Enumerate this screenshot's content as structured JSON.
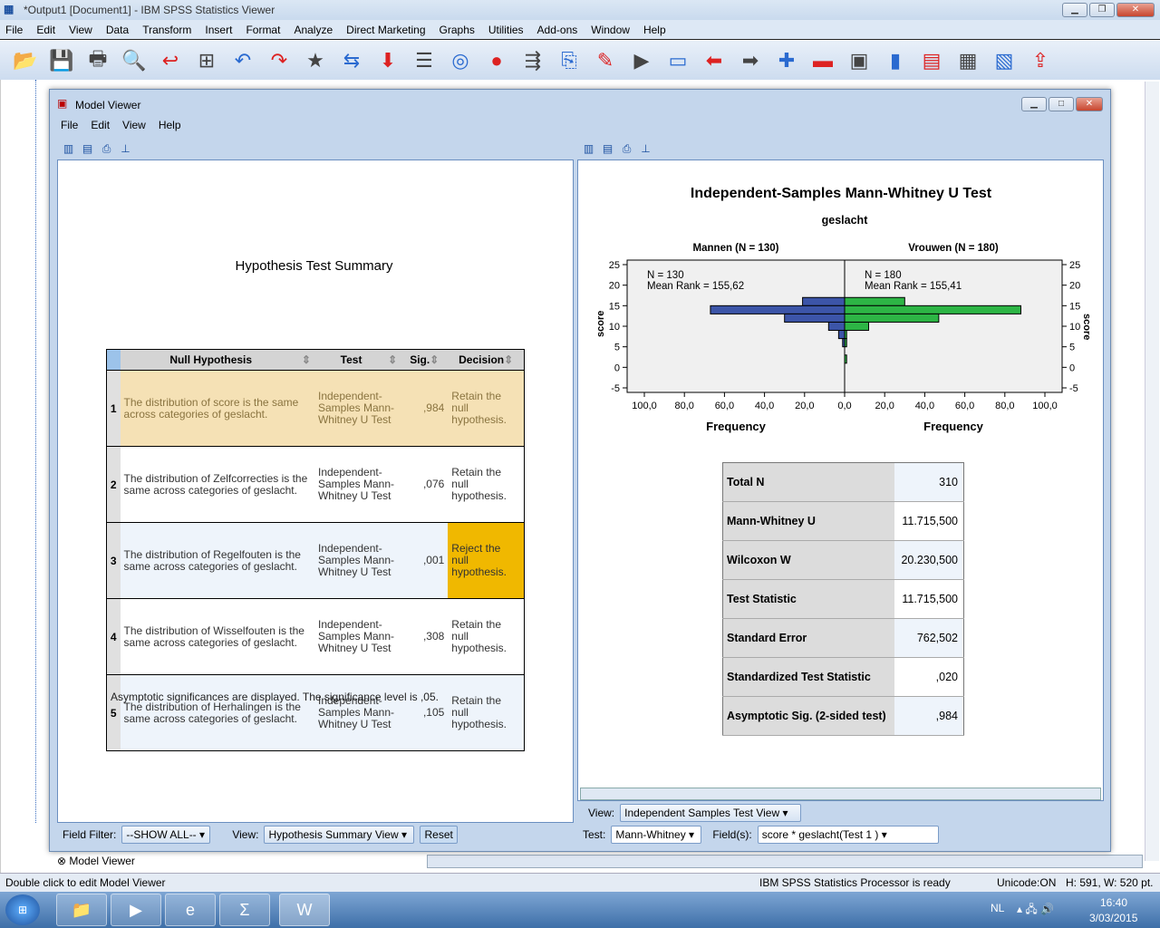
{
  "app": {
    "title": "*Output1 [Document1] - IBM SPSS Statistics Viewer",
    "menu": [
      "File",
      "Edit",
      "View",
      "Data",
      "Transform",
      "Insert",
      "Format",
      "Analyze",
      "Direct Marketing",
      "Graphs",
      "Utilities",
      "Add-ons",
      "Window",
      "Help"
    ],
    "toolbar_icons": [
      "open-icon",
      "save-icon",
      "print-icon",
      "print-preview-icon",
      "export-icon",
      "recall-dialog-icon",
      "undo-icon",
      "redo-icon",
      "goto-case-icon",
      "goto-variable-icon",
      "insert-cases-icon",
      "variables-icon",
      "select-icon",
      "weight-icon",
      "output-outline-icon",
      "insert-output-icon",
      "script-icon",
      "play-icon",
      "designate-window-icon",
      "back-icon",
      "forward-icon",
      "expand-icon",
      "collapse-icon",
      "show-icon",
      "hide-icon",
      "insert-heading-icon",
      "insert-title-icon",
      "insert-text-icon",
      "export-output-icon"
    ],
    "outline_item": "Model Viewer"
  },
  "model_viewer": {
    "title": "Model Viewer",
    "menu": [
      "File",
      "Edit",
      "View",
      "Help"
    ],
    "left": {
      "title": "Hypothesis Test Summary",
      "columns": [
        "Null Hypothesis",
        "Test",
        "Sig.",
        "Decision"
      ],
      "rows": [
        {
          "n": "1",
          "hyp": "The distribution of score is the same across categories of geslacht.",
          "test": "Independent-Samples Mann-Whitney U Test",
          "sig": ",984",
          "decision": "Retain the null hypothesis."
        },
        {
          "n": "2",
          "hyp": "The distribution of Zelfcorrecties is the same across categories of geslacht.",
          "test": "Independent-Samples Mann-Whitney U Test",
          "sig": ",076",
          "decision": "Retain the null hypothesis."
        },
        {
          "n": "3",
          "hyp": "The distribution of Regelfouten is the same across categories of geslacht.",
          "test": "Independent-Samples Mann-Whitney U Test",
          "sig": ",001",
          "decision": "Reject the null hypothesis."
        },
        {
          "n": "4",
          "hyp": "The distribution of Wisselfouten is the same across categories of geslacht.",
          "test": "Independent-Samples Mann-Whitney U Test",
          "sig": ",308",
          "decision": "Retain the null hypothesis."
        },
        {
          "n": "5",
          "hyp": "The distribution of Herhalingen is the same across categories of geslacht.",
          "test": "Independent-Samples Mann-Whitney U Test",
          "sig": ",105",
          "decision": "Retain the null hypothesis."
        }
      ],
      "footnote": "Asymptotic significances are displayed.  The significance level is ,05.",
      "field_filter_label": "Field Filter:",
      "field_filter_value": "--SHOW ALL--",
      "view_label": "View:",
      "view_value": "Hypothesis Summary View",
      "reset_label": "Reset"
    },
    "right": {
      "title": "Independent-Samples Mann-Whitney U Test",
      "subtitle": "geslacht",
      "stats": [
        {
          "label": "Total N",
          "value": "310"
        },
        {
          "label": "Mann-Whitney U",
          "value": "11.715,500"
        },
        {
          "label": "Wilcoxon W",
          "value": "20.230,500"
        },
        {
          "label": "Test Statistic",
          "value": "11.715,500"
        },
        {
          "label": "Standard Error",
          "value": "762,502"
        },
        {
          "label": "Standardized Test Statistic",
          "value": ",020"
        },
        {
          "label": "Asymptotic Sig. (2-sided test)",
          "value": ",984"
        }
      ],
      "view_label": "View:",
      "view_value": "Independent Samples Test View",
      "test_label": "Test:",
      "test_value": "Mann-Whitney",
      "fields_label": "Field(s):",
      "fields_value": "score * geslacht(Test 1 )"
    }
  },
  "chart_data": {
    "type": "bar",
    "orientation": "horizontal-back-to-back",
    "ylabel": "score",
    "xlabel": "Frequency",
    "ylim": [
      -5,
      25
    ],
    "yticks": [
      "25",
      "20",
      "15",
      "10",
      "5",
      "0",
      "-5"
    ],
    "xlim": [
      0,
      100
    ],
    "xticks": [
      "100,0",
      "80,0",
      "60,0",
      "40,0",
      "20,0",
      "0,0"
    ],
    "xticks_right": [
      "0,0",
      "20,0",
      "40,0",
      "60,0",
      "80,0",
      "100,0"
    ],
    "bins": [
      16,
      14,
      12,
      10,
      8,
      6,
      2
    ],
    "series": [
      {
        "name": "Mannen (N = 130)",
        "values": [
          21,
          67,
          30,
          8,
          3,
          1,
          0
        ],
        "color": "#3c55a8",
        "n_text": "N = 130",
        "mean_rank_text": "Mean Rank = 155,62"
      },
      {
        "name": "Vrouwen (N = 180)",
        "values": [
          30,
          88,
          47,
          12,
          1,
          1,
          1
        ],
        "color": "#2db545",
        "n_text": "N = 180",
        "mean_rank_text": "Mean Rank = 155,41"
      }
    ]
  },
  "status": {
    "left": "Double click to edit Model Viewer",
    "processor": "IBM SPSS Statistics Processor is ready",
    "unicode": "Unicode:ON",
    "dims": "H: 591, W: 520 pt."
  },
  "taskbar": {
    "lang": "NL",
    "time": "16:40",
    "date": "3/03/2015"
  },
  "colors": {
    "highlight_row": "#f5e1b5",
    "reject": "#f0b800",
    "alt_row": "#eef4fb"
  }
}
